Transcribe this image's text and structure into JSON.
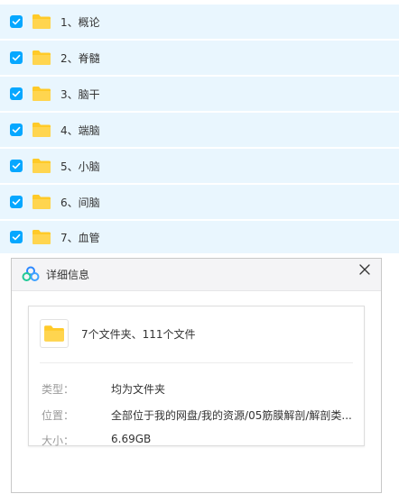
{
  "folders": [
    {
      "name": "1、概论",
      "checked": true
    },
    {
      "name": "2、脊髓",
      "checked": true
    },
    {
      "name": "3、脑干",
      "checked": true
    },
    {
      "name": "4、端脑",
      "checked": true
    },
    {
      "name": "5、小脑",
      "checked": true
    },
    {
      "name": "6、间脑",
      "checked": true
    },
    {
      "name": "7、血管",
      "checked": true
    }
  ],
  "dialog": {
    "title": "详细信息",
    "summary": "7个文件夹、111个文件",
    "type_label": "类型：",
    "type_value": "均为文件夹",
    "location_label": "位置：",
    "location_value": "全部位于我的网盘/我的资源/05筋膜解剖/解剖类...",
    "size_label": "大小：",
    "size_value": "6.69GB"
  },
  "colors": {
    "row_selected_bg": "#e9f6fe",
    "checkbox_accent": "#06a7ff",
    "folder_yellow": "#ffca28"
  },
  "icons": {
    "checkbox": "checkbox-checked-icon",
    "folder": "folder-icon",
    "logo": "baidu-netdisk-logo-icon",
    "close": "close-icon"
  }
}
